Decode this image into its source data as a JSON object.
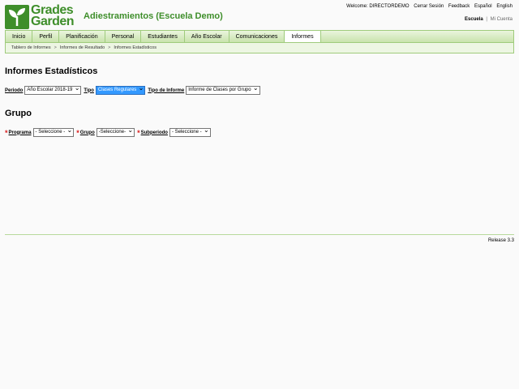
{
  "logo": {
    "line1": "Grades",
    "line2": "Garden"
  },
  "school_title": "Adiestramientos (Escuela Demo)",
  "top_links": {
    "welcome": "Welcome: DIRECTORDEMO",
    "logout": "Cerrar Sesión",
    "feedback": "Feedback",
    "spanish": "Español",
    "english": "English"
  },
  "sub_links": {
    "school": "Escuela",
    "sep": "|",
    "account": "Mi Cuenta"
  },
  "nav": {
    "items": [
      "Inicio",
      "Perfil",
      "Planificación",
      "Personal",
      "Estudiantes",
      "Año Escolar",
      "Comunicaciones",
      "Informes"
    ],
    "active": "Informes"
  },
  "breadcrumb": [
    "Tablero de Informes",
    "Informes de Resultado",
    "Informes Estadísticos"
  ],
  "breadcrumb_sep": ">",
  "page_title": "Informes Estadísticos",
  "filters": {
    "period_label": "Periodo",
    "period_value": "Año Escolar 2018-19",
    "type_label": "Tipo",
    "type_value": "Clases Regulares",
    "report_type_label": "Tipo de Informe",
    "report_type_value": "Informe de Clases por Grupo"
  },
  "group_section": {
    "title": "Grupo",
    "required_mark": "*",
    "program_label": "Programa",
    "program_value": "- Seleccione -",
    "group_label": "Grupo",
    "group_value": "-Seleccione-",
    "subperiod_label": "Subperiodo",
    "subperiod_value": "- Seleccione -"
  },
  "release": "Release 3.3",
  "colors": {
    "brand_green": "#3e8e2a",
    "required_red": "#d91c1c",
    "highlight_blue": "#3399ff"
  }
}
